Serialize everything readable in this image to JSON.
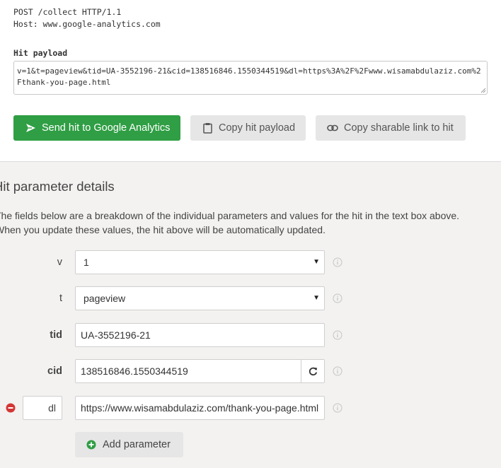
{
  "request": {
    "line1": "POST /collect HTTP/1.1",
    "line2": "Host: www.google-analytics.com"
  },
  "payload": {
    "label": "Hit payload",
    "value": "v=1&t=pageview&tid=UA-3552196-21&cid=138516846.1550344519&dl=https%3A%2F%2Fwww.wisamabdulaziz.com%2Fthank-you-page.html"
  },
  "buttons": {
    "send": "Send hit to Google Analytics",
    "copy_payload": "Copy hit payload",
    "copy_link": "Copy sharable link to hit",
    "add_parameter": "Add parameter"
  },
  "details": {
    "title": "Hit parameter details",
    "desc_line1": "The fields below are a breakdown of the individual parameters and values for the hit in the text box above.",
    "desc_line2": "When you update these values, the hit above will be automatically updated."
  },
  "params": {
    "v": {
      "label": "v",
      "value": "1"
    },
    "t": {
      "label": "t",
      "value": "pageview"
    },
    "tid": {
      "label": "tid",
      "value": "UA-3552196-21"
    },
    "cid": {
      "label": "cid",
      "value": "138516846.1550344519"
    },
    "dl": {
      "label": "dl",
      "value": "https://www.wisamabdulaziz.com/thank-you-page.html"
    }
  },
  "colors": {
    "send_button": "#2f9e44",
    "remove_icon": "#d43535",
    "add_icon": "#2f9e44",
    "section_bg": "#f3f2f0"
  },
  "icons": {
    "send": "paper-plane-icon",
    "copy": "clipboard-icon",
    "link": "link-icon",
    "refresh": "refresh-icon",
    "info": "info-icon",
    "remove": "minus-circle-icon",
    "add": "plus-circle-icon"
  }
}
